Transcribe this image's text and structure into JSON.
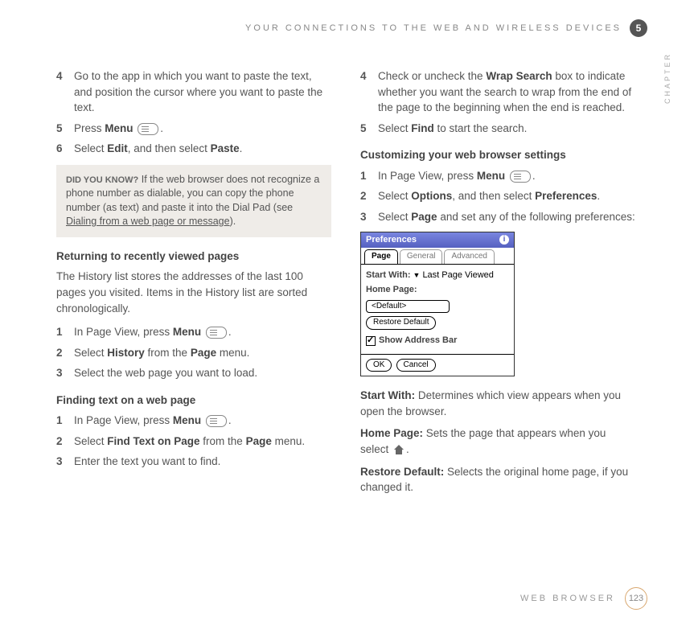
{
  "header": {
    "running_title": "YOUR CONNECTIONS TO THE WEB AND WIRELESS DEVICES",
    "chapter_number": "5",
    "side_label": "CHAPTER"
  },
  "left_column": {
    "steps_a": [
      {
        "num": "4",
        "text_before": "Go to the app in which you want to paste the text, and position the cursor where you want to paste the text."
      },
      {
        "num": "5",
        "text_before": "Press ",
        "bold1": "Menu",
        "icon": "menu",
        "text_after": "."
      },
      {
        "num": "6",
        "text_before": "Select ",
        "bold1": "Edit",
        "text_mid": ", and then select ",
        "bold2": "Paste",
        "text_after": "."
      }
    ],
    "callout": {
      "label": "DID YOU KNOW?",
      "text_before": " If the web browser does not recognize a phone number as dialable, you can copy the phone number (as text) and paste it into the Dial Pad (see ",
      "link": "Dialing from a web page or message",
      "text_after": ")."
    },
    "section_b_title": "Returning to recently viewed pages",
    "section_b_intro": "The History list stores the addresses of the last 100 pages you visited. Items in the History list are sorted chronologically.",
    "steps_b": [
      {
        "num": "1",
        "text_before": "In Page View, press ",
        "bold1": "Menu",
        "icon": "menu",
        "text_after": "."
      },
      {
        "num": "2",
        "text_before": "Select ",
        "bold1": "History",
        "text_mid": " from the ",
        "bold2": "Page",
        "text_after": " menu."
      },
      {
        "num": "3",
        "text_before": "Select the web page you want to load."
      }
    ],
    "section_c_title": "Finding text on a web page",
    "steps_c": [
      {
        "num": "1",
        "text_before": "In Page View, press ",
        "bold1": "Menu",
        "icon": "menu",
        "text_after": "."
      },
      {
        "num": "2",
        "text_before": "Select ",
        "bold1": "Find Text on Page",
        "text_mid": " from the ",
        "bold2": "Page",
        "text_after": " menu."
      },
      {
        "num": "3",
        "text_before": "Enter the text you want to find."
      }
    ]
  },
  "right_column": {
    "steps_a": [
      {
        "num": "4",
        "text_before": "Check or uncheck the ",
        "bold1": "Wrap Search",
        "text_after": " box to indicate whether you want the search to wrap from the end of the page to the beginning when the end is reached."
      },
      {
        "num": "5",
        "text_before": "Select ",
        "bold1": "Find",
        "text_after": " to start the search."
      }
    ],
    "section_b_title": "Customizing your web browser settings",
    "steps_b": [
      {
        "num": "1",
        "text_before": "In Page View, press ",
        "bold1": "Menu",
        "icon": "menu",
        "text_after": "."
      },
      {
        "num": "2",
        "text_before": "Select ",
        "bold1": "Options",
        "text_mid": ", and then select ",
        "bold2": "Preferences",
        "text_after": "."
      },
      {
        "num": "3",
        "text_before": "Select ",
        "bold1": "Page",
        "text_after": " and set any of the following preferences:"
      }
    ],
    "prefs_dialog": {
      "title": "Preferences",
      "tabs": [
        "Page",
        "General",
        "Advanced"
      ],
      "start_with_label": "Start With:",
      "start_with_value": "Last Page Viewed",
      "home_page_label": "Home Page:",
      "home_page_value": "<Default>",
      "restore_default": "Restore Default",
      "show_address": "Show Address Bar",
      "ok": "OK",
      "cancel": "Cancel"
    },
    "descriptions": [
      {
        "label": "Start With:",
        "text": " Determines which view appears when you open the browser."
      },
      {
        "label": "Home Page:",
        "text_before": " Sets the page that appears when you select ",
        "icon": "home",
        "text_after": "."
      },
      {
        "label": "Restore Default:",
        "text": " Selects the original home page, if you changed it."
      }
    ]
  },
  "footer": {
    "section": "WEB BROWSER",
    "page_number": "123"
  }
}
